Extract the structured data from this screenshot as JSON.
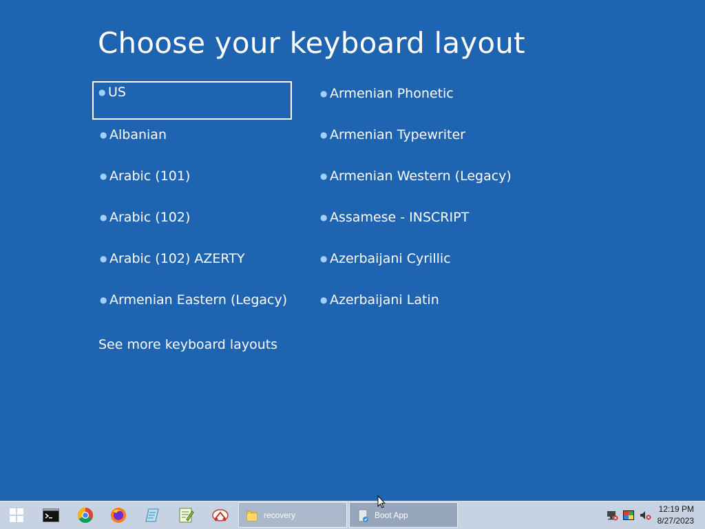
{
  "page": {
    "title": "Choose your keyboard layout",
    "more_link": "See more keyboard layouts"
  },
  "layouts": [
    {
      "label": "US",
      "selected": true
    },
    {
      "label": "Albanian"
    },
    {
      "label": "Arabic (101)"
    },
    {
      "label": "Arabic (102)"
    },
    {
      "label": "Arabic (102) AZERTY"
    },
    {
      "label": "Armenian Eastern (Legacy)"
    },
    {
      "label": "Armenian Phonetic"
    },
    {
      "label": "Armenian Typewriter"
    },
    {
      "label": "Armenian Western (Legacy)"
    },
    {
      "label": "Assamese - INSCRIPT"
    },
    {
      "label": "Azerbaijani Cyrillic"
    },
    {
      "label": "Azerbaijani Latin"
    }
  ],
  "taskbar": {
    "pinned": [
      {
        "icon": "windows-start-icon"
      },
      {
        "icon": "command-prompt-icon"
      },
      {
        "icon": "chrome-icon"
      },
      {
        "icon": "firefox-icon"
      },
      {
        "icon": "notepad-icon"
      },
      {
        "icon": "notepad-plus-icon"
      },
      {
        "icon": "snipping-tool-icon"
      }
    ],
    "tasks": [
      {
        "label": "recovery",
        "icon": "folder-icon"
      },
      {
        "label": "Boot App",
        "icon": "app-icon",
        "active": true
      }
    ],
    "tray": {
      "icons": [
        "network-disconnected-icon",
        "color-palette-icon",
        "volume-muted-icon"
      ],
      "time": "12:19 PM",
      "date": "8/27/2023"
    }
  },
  "colors": {
    "background": "#1f64b1",
    "bullet": "#9fd0ff",
    "taskbar": "#c7d3e2"
  }
}
